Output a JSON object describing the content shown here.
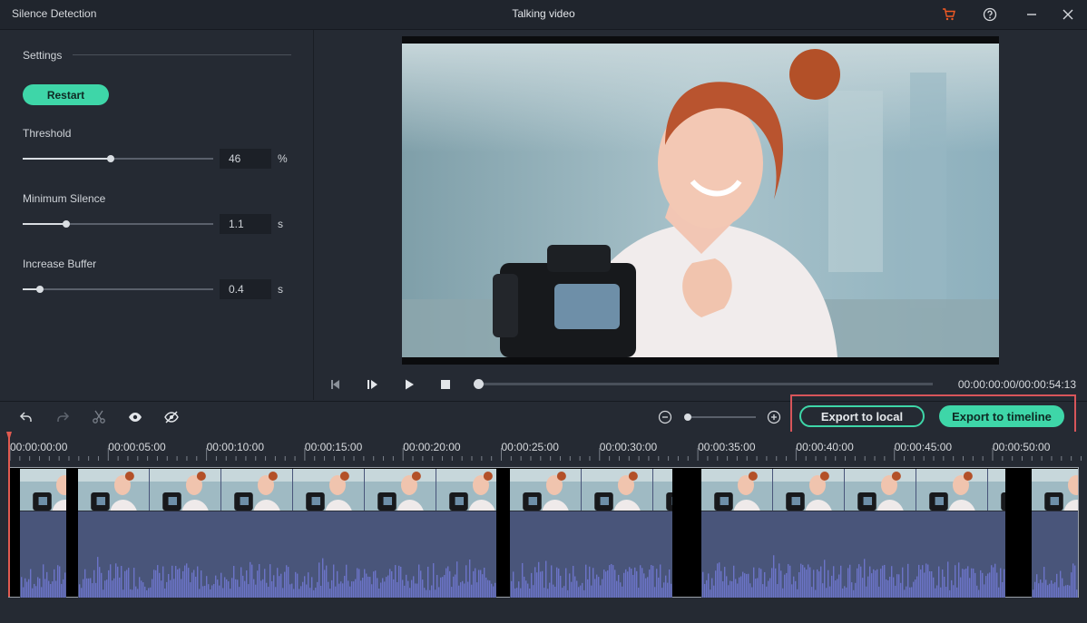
{
  "window": {
    "app_title": "Silence Detection",
    "document_title": "Talking video",
    "icons": [
      "cart-icon",
      "help-icon",
      "minimize-icon",
      "close-icon"
    ],
    "accent_color": "#f15a24"
  },
  "settings": {
    "section_label": "Settings",
    "restart_label": "Restart",
    "threshold": {
      "label": "Threshold",
      "value": "46",
      "unit": "%",
      "level": 0.46
    },
    "min_silence": {
      "label": "Minimum Silence",
      "value": "1.1",
      "unit": "s",
      "level": 0.23
    },
    "increase_buffer": {
      "label": "Increase Buffer",
      "value": "0.4",
      "unit": "s",
      "level": 0.09
    }
  },
  "player": {
    "timecode": "00:00:00:00/00:00:54:13",
    "progress": 0.0
  },
  "toolbar": {
    "export_local_label": "Export to local",
    "export_timeline_label": "Export to timeline",
    "zoom_level": 0.0
  },
  "ruler": {
    "labels": [
      "00:00:00:00",
      "00:00:05:00",
      "00:00:10:00",
      "00:00:15:00",
      "00:00:20:00",
      "00:00:25:00",
      "00:00:30:00",
      "00:00:35:00",
      "00:00:40:00",
      "00:00:45:00",
      "00:00:50:00"
    ]
  },
  "colors": {
    "accent_green": "#3ed6a8",
    "highlight_red": "#d8555a",
    "waveform": "#6c74c8",
    "playhead": "#e05a50"
  }
}
